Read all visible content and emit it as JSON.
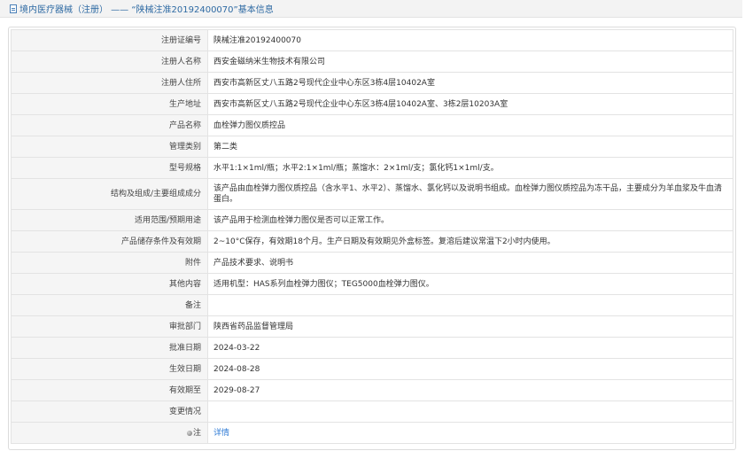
{
  "header": {
    "title": "境内医疗器械（注册） —— “陕械注准20192400070”基本信息"
  },
  "rows": [
    {
      "label": "注册证编号",
      "value": "陕械注准20192400070"
    },
    {
      "label": "注册人名称",
      "value": "西安金磁纳米生物技术有限公司"
    },
    {
      "label": "注册人住所",
      "value": "西安市高新区丈八五路2号现代企业中心东区3栋4层10402A室"
    },
    {
      "label": "生产地址",
      "value": "西安市高新区丈八五路2号现代企业中心东区3栋4层10402A室、3栋2层10203A室"
    },
    {
      "label": "产品名称",
      "value": "血栓弹力图仪质控品"
    },
    {
      "label": "管理类别",
      "value": "第二类"
    },
    {
      "label": "型号规格",
      "value": "水平1:1×1ml/瓶；水平2:1×1ml/瓶；蒸馏水：2×1ml/支；氯化钙1×1ml/支。"
    },
    {
      "label": "结构及组成/主要组成成分",
      "value": "该产品由血栓弹力图仪质控品（含水平1、水平2）、蒸馏水、氯化钙以及说明书组成。血栓弹力图仪质控品为冻干品，主要成分为羊血浆及牛血清蛋白。"
    },
    {
      "label": "适用范围/预期用途",
      "value": "该产品用于检测血栓弹力图仪是否可以正常工作。"
    },
    {
      "label": "产品储存条件及有效期",
      "value": "2~10°C保存，有效期18个月。生产日期及有效期见外盒标签。复溶后建议常温下2小时内使用。"
    },
    {
      "label": "附件",
      "value": "产品技术要求、说明书"
    },
    {
      "label": "其他内容",
      "value": "适用机型：HAS系列血栓弹力图仪；TEG5000血栓弹力图仪。"
    },
    {
      "label": "备注",
      "value": ""
    },
    {
      "label": "审批部门",
      "value": "陕西省药品监督管理局"
    },
    {
      "label": "批准日期",
      "value": "2024-03-22"
    },
    {
      "label": "生效日期",
      "value": "2024-08-28"
    },
    {
      "label": "有效期至",
      "value": "2029-08-27"
    },
    {
      "label": "变更情况",
      "value": ""
    }
  ],
  "note": {
    "label": "注",
    "link": "详情"
  },
  "icons": {
    "title": "document-icon",
    "note": "bulb-icon"
  },
  "colors": {
    "title": "#2e6aa3",
    "link": "#2f7bd6",
    "label_bg": "#f5f5f5",
    "border": "#e3e3e3"
  }
}
